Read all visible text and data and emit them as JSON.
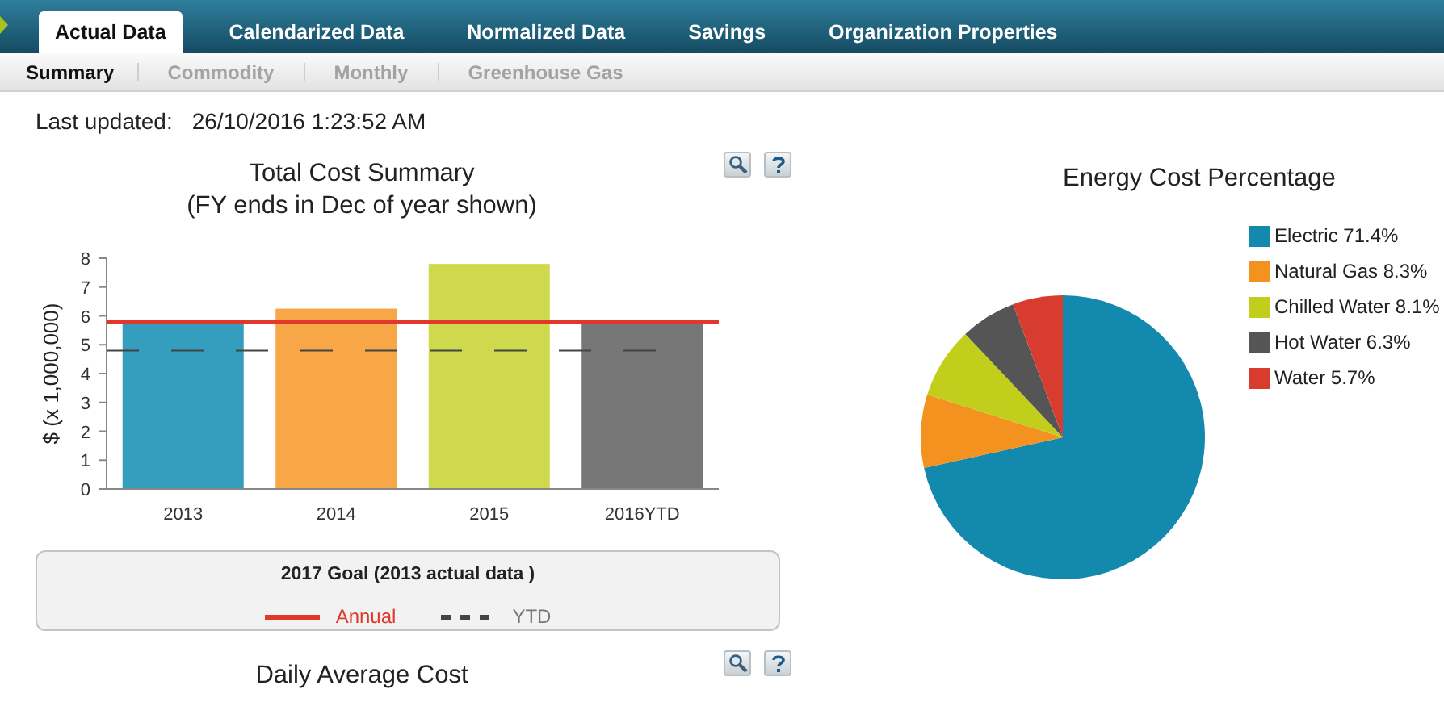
{
  "tabs": [
    {
      "label": "Actual Data",
      "selected": true
    },
    {
      "label": "Calendarized Data",
      "selected": false
    },
    {
      "label": "Normalized Data",
      "selected": false
    },
    {
      "label": "Savings",
      "selected": false
    },
    {
      "label": "Organization Properties",
      "selected": false
    }
  ],
  "subtabs": [
    {
      "label": "Summary",
      "selected": true
    },
    {
      "label": "Commodity",
      "selected": false
    },
    {
      "label": "Monthly",
      "selected": false
    },
    {
      "label": "Greenhouse Gas",
      "selected": false
    }
  ],
  "last_updated": {
    "label": "Last updated:",
    "value": "26/10/2016 1:23:52 AM"
  },
  "cost_summary": {
    "title": "Total Cost Summary",
    "subtitle": "(FY ends in Dec of year shown)",
    "chart_data": {
      "type": "bar",
      "ylabel": "$ (x 1,000,000)",
      "categories": [
        "2013",
        "2014",
        "2015",
        "2016YTD"
      ],
      "values": [
        5.85,
        6.25,
        7.8,
        5.85
      ],
      "colors": [
        "#359dbd",
        "#f7a748",
        "#cfd94e",
        "#777777"
      ],
      "ylim": [
        0,
        8
      ],
      "yticks": [
        0,
        1,
        2,
        3,
        4,
        5,
        6,
        7,
        8
      ],
      "ref_lines": [
        {
          "axis": "y",
          "value": 5.8,
          "color": "#e0392b",
          "label": "Annual"
        },
        {
          "axis": "y",
          "value": 4.8,
          "color": "#444444",
          "label": "YTD"
        }
      ]
    },
    "legend": {
      "title": "2017 Goal (2013 actual data )",
      "items": [
        {
          "kind": "solid"
        },
        {
          "kind": "dashed"
        }
      ]
    }
  },
  "energy_cost": {
    "chart_data": {
      "type": "pie",
      "title": "Energy Cost Percentage",
      "categories": [
        "Electric 71.4%",
        "Natural Gas 8.3%",
        "Chilled Water 8.1%",
        "Hot Water 6.3%",
        "Water 5.7%"
      ],
      "values": [
        71.4,
        8.3,
        8.1,
        6.3,
        5.7
      ],
      "colors": [
        "#1389ad",
        "#f3921f",
        "#c1cf1c",
        "#555555",
        "#d83c2f"
      ]
    }
  },
  "daily_average": {
    "title": "Daily Average Cost"
  }
}
